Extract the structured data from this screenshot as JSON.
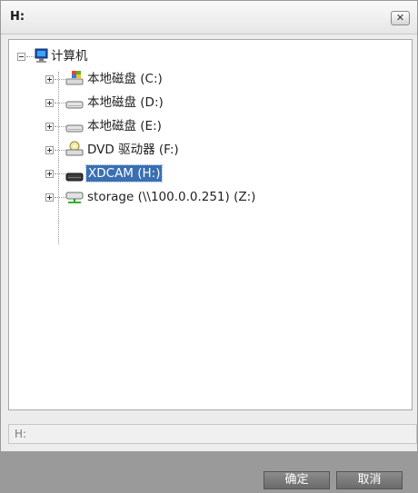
{
  "window": {
    "title": "H:"
  },
  "tree": {
    "root": {
      "label": "计算机",
      "icon": "computer-icon"
    },
    "items": [
      {
        "label": "本地磁盘 (C:)",
        "icon": "windows-drive-icon"
      },
      {
        "label": "本地磁盘 (D:)",
        "icon": "hard-drive-icon"
      },
      {
        "label": "本地磁盘 (E:)",
        "icon": "hard-drive-icon"
      },
      {
        "label": "DVD 驱动器 (F:)",
        "icon": "dvd-drive-icon"
      },
      {
        "label": "XDCAM (H:)",
        "icon": "xdcam-drive-icon",
        "selected": true
      },
      {
        "label": "storage (\\\\100.0.0.251) (Z:)",
        "icon": "network-drive-icon"
      }
    ]
  },
  "path_field": {
    "value": "H:"
  },
  "buttons": {
    "ok": "确定",
    "cancel": "取消"
  },
  "colors": {
    "selection": "#3a6fb2",
    "footer": "#9a9a9a"
  }
}
